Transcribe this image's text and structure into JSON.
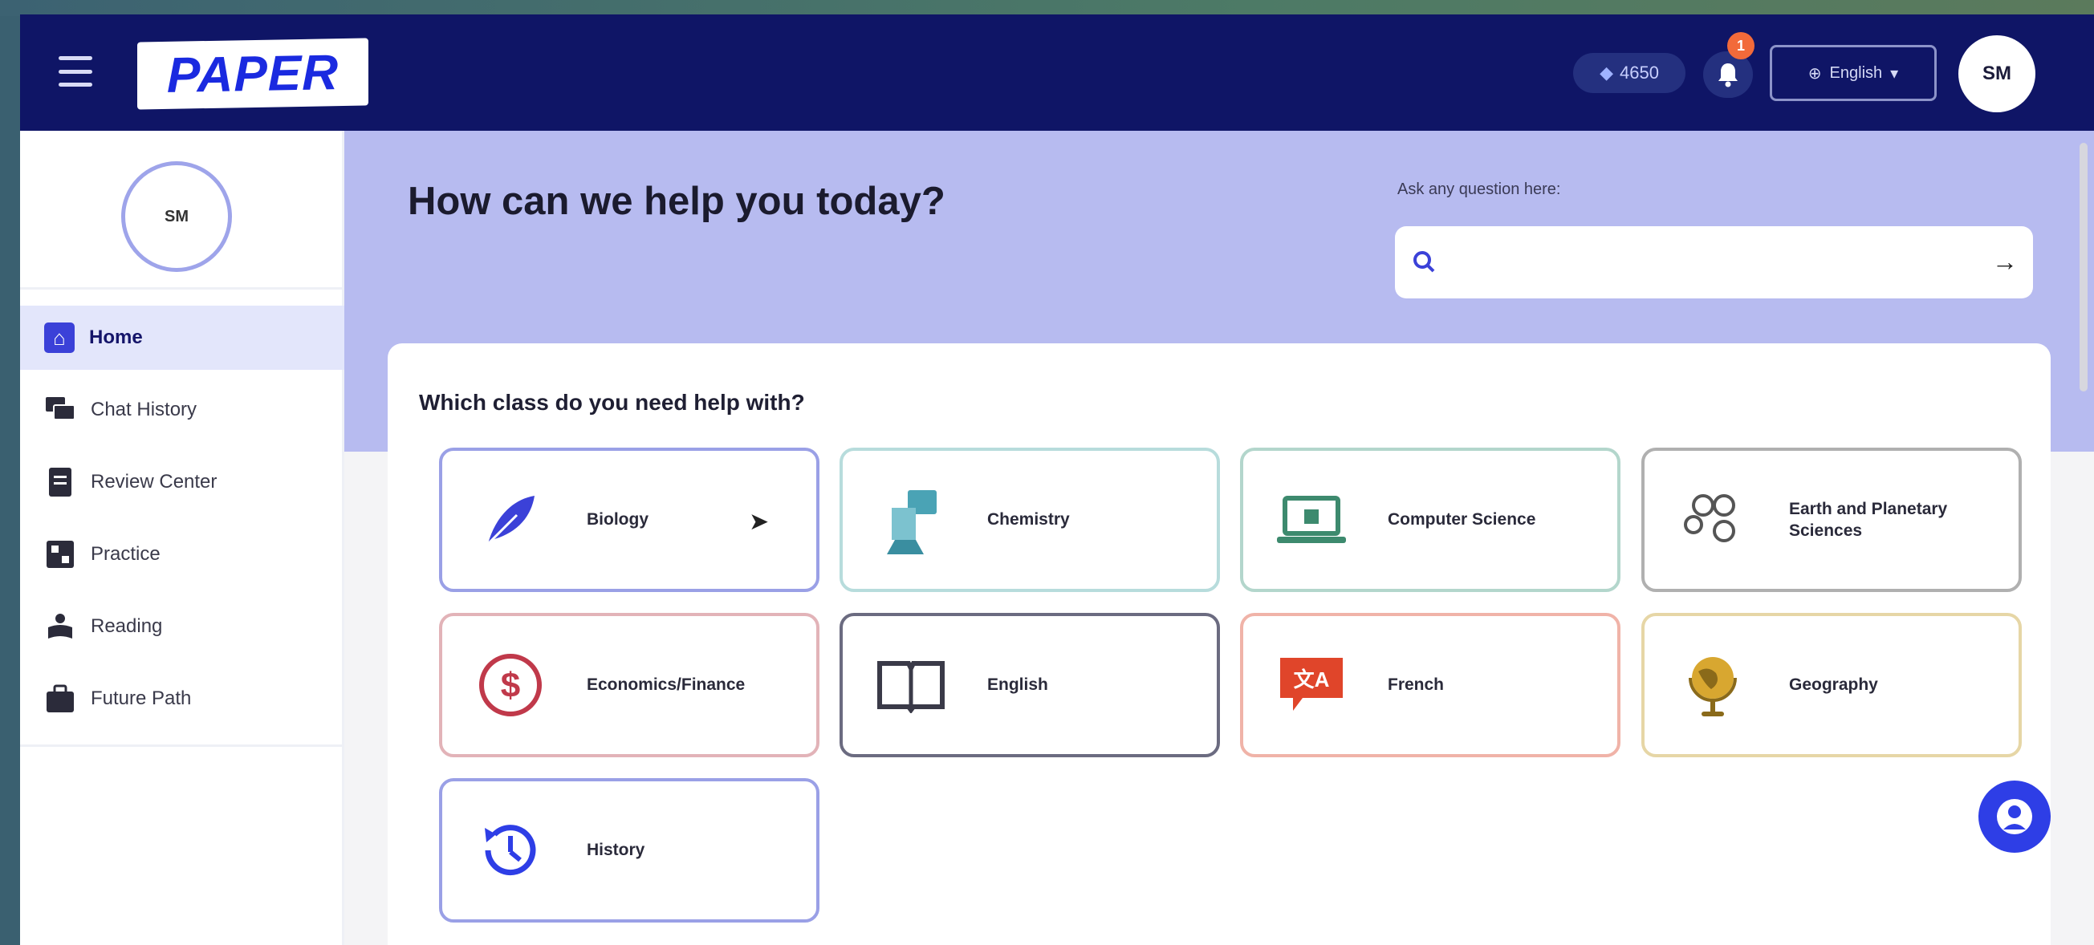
{
  "header": {
    "logo_text": "PAPER",
    "gems": "4650",
    "notification_count": "1",
    "language": "English",
    "user_initials": "SM"
  },
  "sidebar": {
    "user_initials": "SM",
    "items": [
      {
        "label": "Home",
        "icon": "home-icon",
        "active": true
      },
      {
        "label": "Chat History",
        "icon": "chat-history-icon",
        "active": false
      },
      {
        "label": "Review Center",
        "icon": "review-center-icon",
        "active": false
      },
      {
        "label": "Practice",
        "icon": "practice-icon",
        "active": false
      },
      {
        "label": "Reading",
        "icon": "reading-icon",
        "active": false
      },
      {
        "label": "Future Path",
        "icon": "future-path-icon",
        "active": false
      }
    ]
  },
  "hero": {
    "title": "How can we help you today?",
    "ask_label": "Ask any question here:",
    "ask_placeholder": ""
  },
  "classes": {
    "heading": "Which class do you need help with?",
    "items": [
      {
        "label": "Biology",
        "icon": "feather-icon",
        "border": "#9aa0e6"
      },
      {
        "label": "Chemistry",
        "icon": "chemistry-icon",
        "border": "#b7dcdc"
      },
      {
        "label": "Computer Science",
        "icon": "laptop-icon",
        "border": "#b3d6cc"
      },
      {
        "label": "Earth and Planetary Sciences",
        "icon": "molecule-icon",
        "border": "#b0b0b0"
      },
      {
        "label": "Economics/Finance",
        "icon": "dollar-icon",
        "border": "#e2b3b8"
      },
      {
        "label": "English",
        "icon": "book-icon",
        "border": "#6b6b80"
      },
      {
        "label": "French",
        "icon": "speech-bubble-icon",
        "border": "#f0b3a8"
      },
      {
        "label": "Geography",
        "icon": "globe-icon",
        "border": "#e6d6a6"
      },
      {
        "label": "History",
        "icon": "history-icon",
        "border": "#9aa0e6"
      }
    ]
  },
  "colors": {
    "header_bg": "#0f1566",
    "hero_bg": "#b7bbf0",
    "accent": "#3b41d8"
  }
}
